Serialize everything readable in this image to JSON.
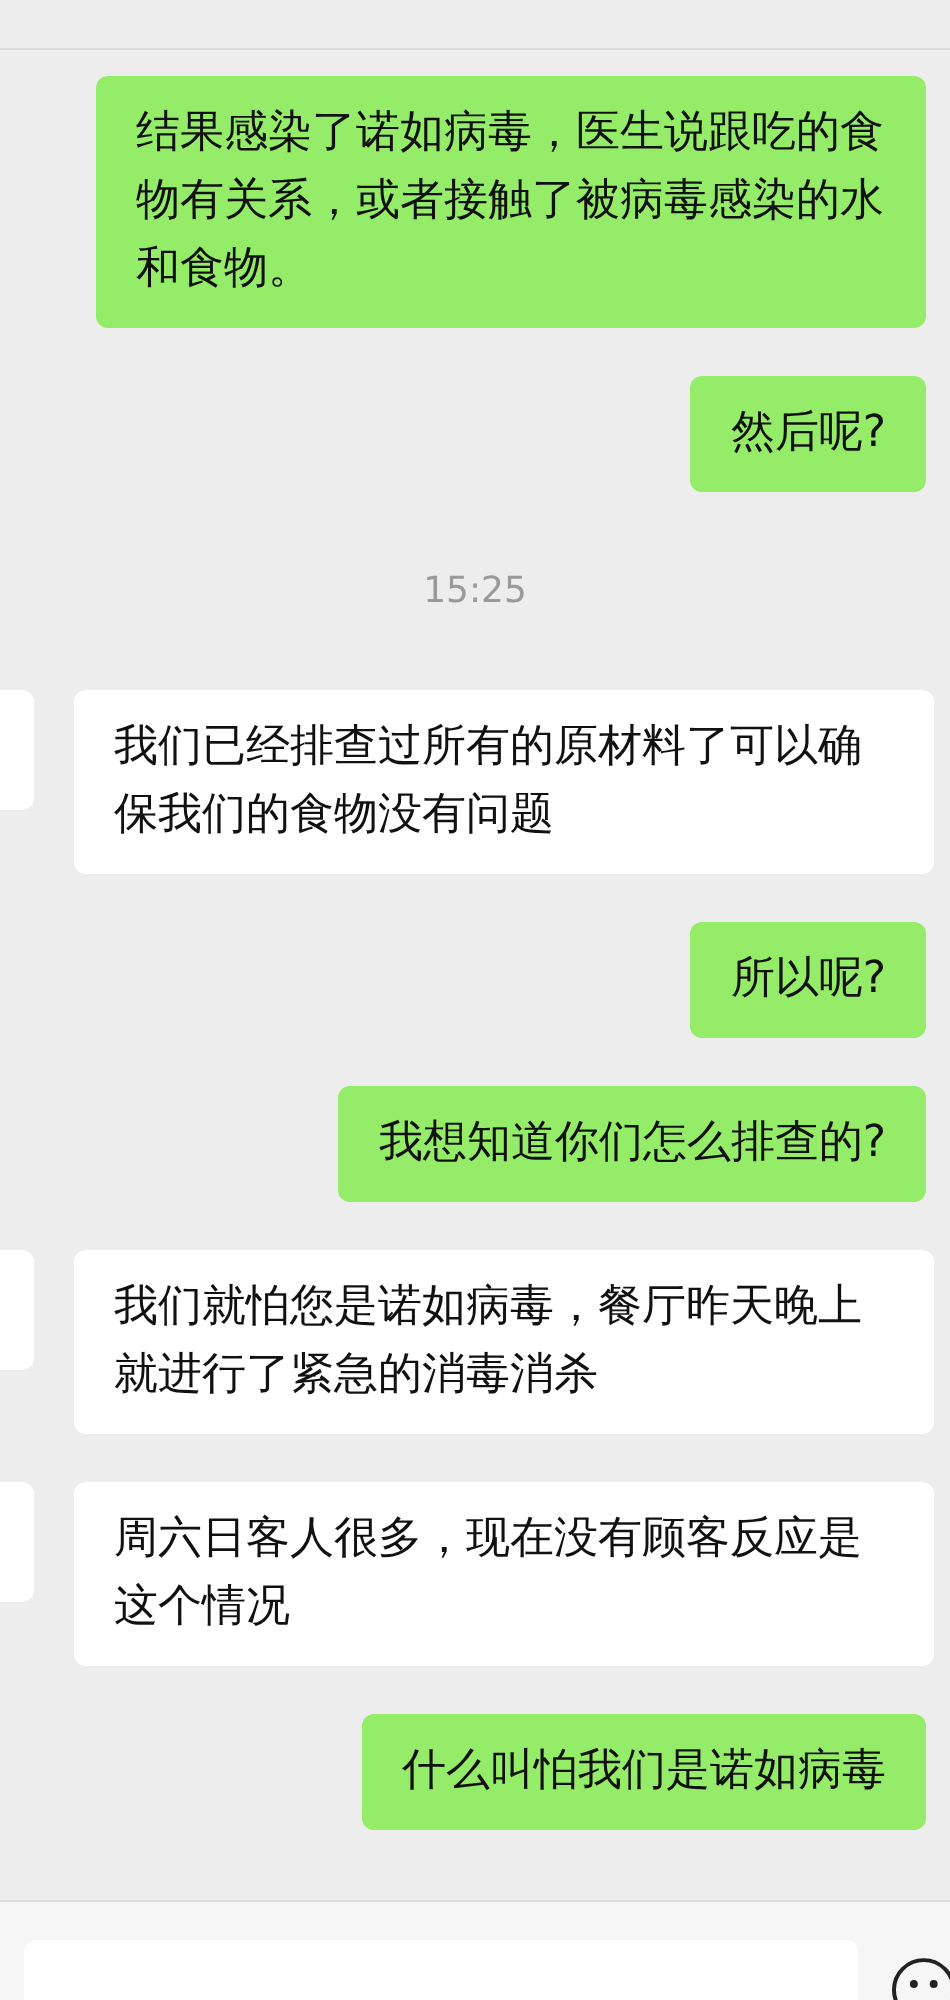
{
  "messages": [
    {
      "kind": "sent",
      "text": "结果感染了诺如病毒，医生说跟吃的食物有关系，或者接触了被病毒感染的水和食物。"
    },
    {
      "kind": "sent",
      "text": "然后呢?"
    },
    {
      "kind": "time",
      "text": "15:25"
    },
    {
      "kind": "received",
      "text": "我们已经排查过所有的原材料了可以确保我们的食物没有问题"
    },
    {
      "kind": "sent",
      "text": "所以呢?"
    },
    {
      "kind": "sent",
      "text": "我想知道你们怎么排查的?"
    },
    {
      "kind": "received",
      "text": "我们就怕您是诺如病毒，餐厅昨天晚上就进行了紧急的消毒消杀"
    },
    {
      "kind": "received",
      "text": "周六日客人很多，现在没有顾客反应是这个情况"
    },
    {
      "kind": "sent",
      "text": "什么叫怕我们是诺如病毒"
    }
  ]
}
